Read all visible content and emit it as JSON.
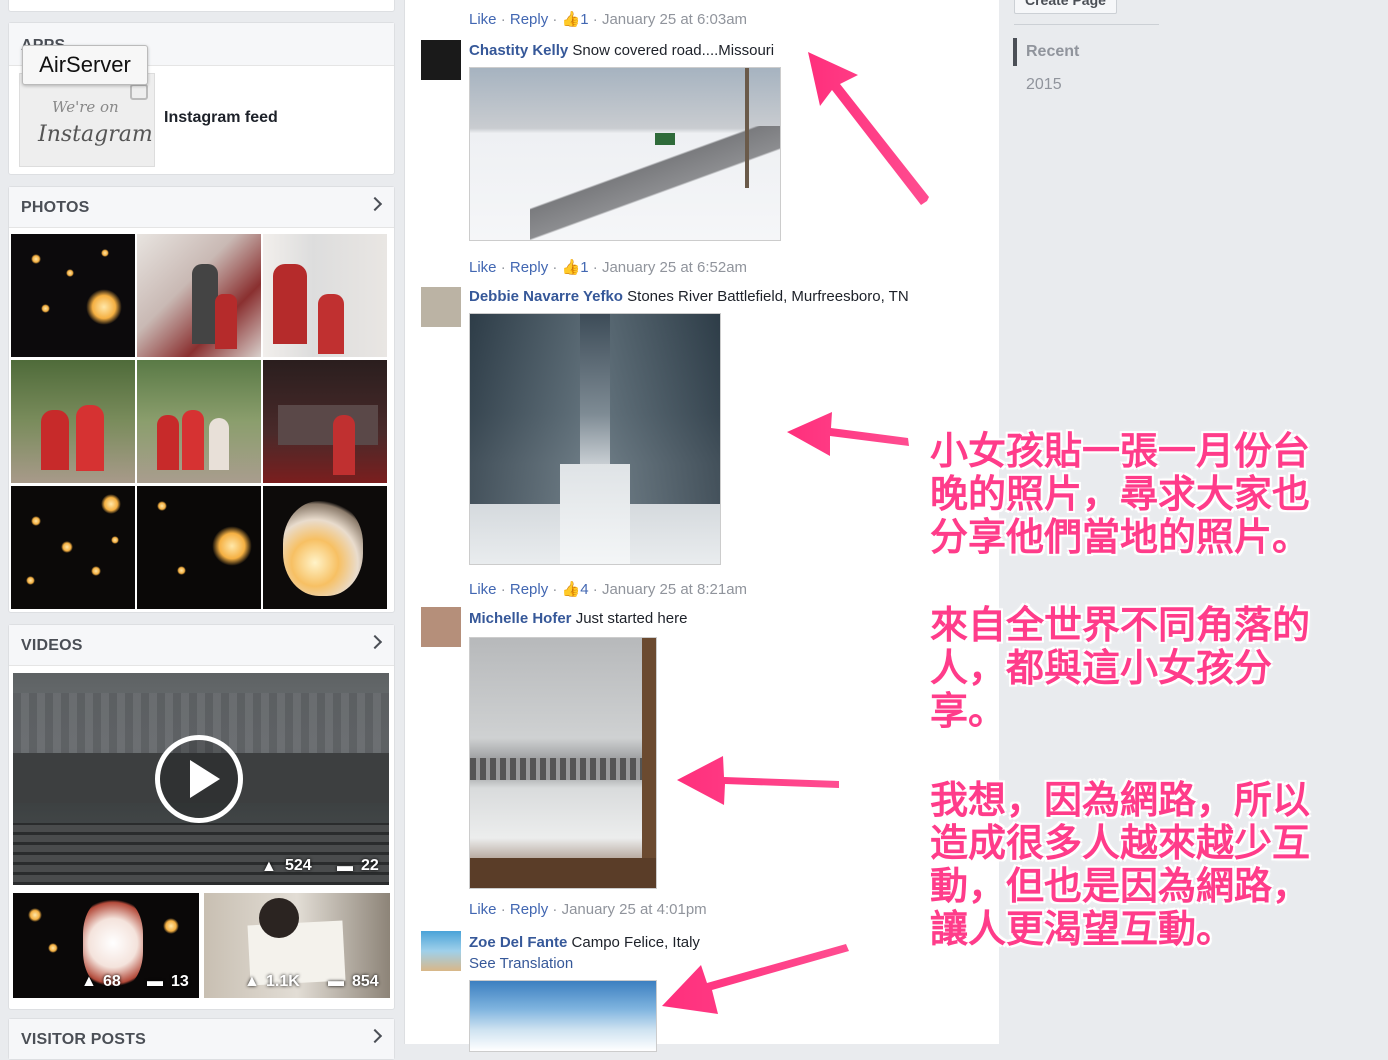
{
  "apps": {
    "header": "APPS",
    "tooltip": "AirServer",
    "instagram_logo_top": "We're on",
    "instagram_logo_bottom": "Instagram",
    "item_label": "Instagram feed"
  },
  "photos": {
    "header": "PHOTOS"
  },
  "videos": {
    "header": "VIDEOS",
    "main": {
      "likes": "524",
      "comments": "22"
    },
    "small": [
      {
        "likes": "68",
        "comments": "13"
      },
      {
        "likes": "1.1K",
        "comments": "854"
      }
    ]
  },
  "visitor_posts": {
    "header": "VISITOR POSTS"
  },
  "comments": [
    {
      "meta_like": "Like",
      "meta_reply": "Reply",
      "meta_rest": " · ",
      "likes": "1",
      "time": "January 25 at 6:03am"
    },
    {
      "author": "Chastity Kelly",
      "text": "Snow covered road....Missouri",
      "meta_like": "Like",
      "meta_reply": "Reply",
      "likes": "1",
      "time": "January 25 at 6:52am"
    },
    {
      "author": "Debbie Navarre Yefko",
      "text": "Stones River Battlefield, Murfreesboro, TN",
      "meta_like": "Like",
      "meta_reply": "Reply",
      "likes": "4",
      "time": "January 25 at 8:21am"
    },
    {
      "author": "Michelle Hofer",
      "text": "Just started here",
      "meta_like": "Like",
      "meta_reply": "Reply",
      "time": "January 25 at 4:01pm"
    },
    {
      "author": "Zoe Del Fante",
      "text": "Campo Felice, Italy",
      "see_translation": "See Translation"
    }
  ],
  "sidebar_right": {
    "create_page": "Create Page",
    "timeline": [
      "Recent",
      "2015"
    ]
  },
  "annotations": {
    "para1": [
      "小女孩貼一張一月份台",
      "晚的照片，尋求大家也",
      "分享他們當地的照片。"
    ],
    "para2": [
      "來自全世界不同角落的",
      "人，都與這小女孩分",
      "享。"
    ],
    "para3": [
      "我想，因為網路，所以",
      "造成很多人越來越少互",
      "動，但也是因為網路，",
      "讓人更渴望互動。"
    ]
  },
  "colors": {
    "link": "#365899",
    "annotation": "#ff3c8a",
    "meta": "#90949c"
  }
}
